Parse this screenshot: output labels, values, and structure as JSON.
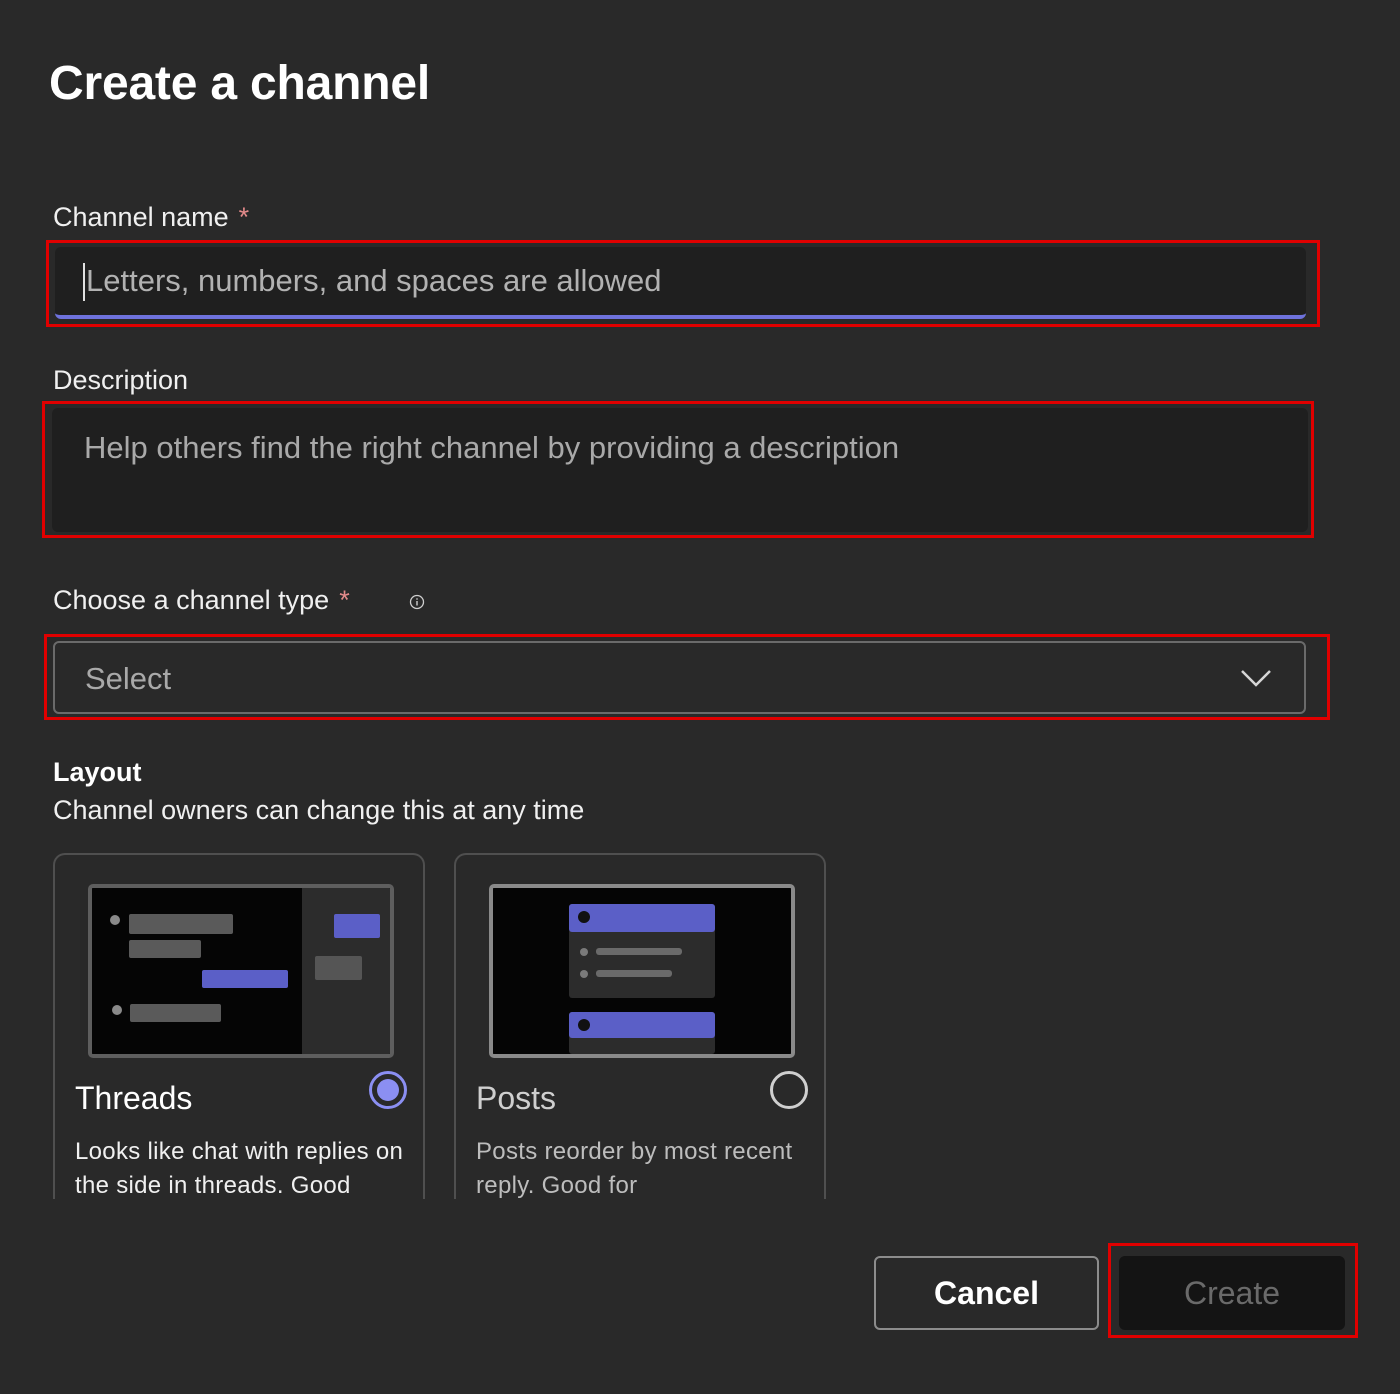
{
  "dialog": {
    "title": "Create a channel"
  },
  "channel_name": {
    "label": "Channel name",
    "required_mark": "*",
    "placeholder": "Letters, numbers, and spaces are allowed",
    "value": ""
  },
  "description": {
    "label": "Description",
    "placeholder": "Help others find the right channel by providing a description",
    "value": ""
  },
  "channel_type": {
    "label": "Choose a channel type",
    "required_mark": "*",
    "info_icon": "info-icon",
    "selected": "Select",
    "dropdown_icon": "chevron-down-icon"
  },
  "layout": {
    "title": "Layout",
    "subtitle": "Channel owners can change this at any time",
    "options": [
      {
        "name": "Threads",
        "description": "Looks like chat with replies on the side in threads. Good",
        "selected": true
      },
      {
        "name": "Posts",
        "description": "Posts reorder by most recent reply. Good for",
        "selected": false
      }
    ]
  },
  "buttons": {
    "cancel": "Cancel",
    "create": "Create"
  },
  "colors": {
    "background": "#292929",
    "field_background": "#1f1f1f",
    "accent": "#6e72dc",
    "radio_accent": "#8b8ff2",
    "highlight": "#e00000"
  }
}
